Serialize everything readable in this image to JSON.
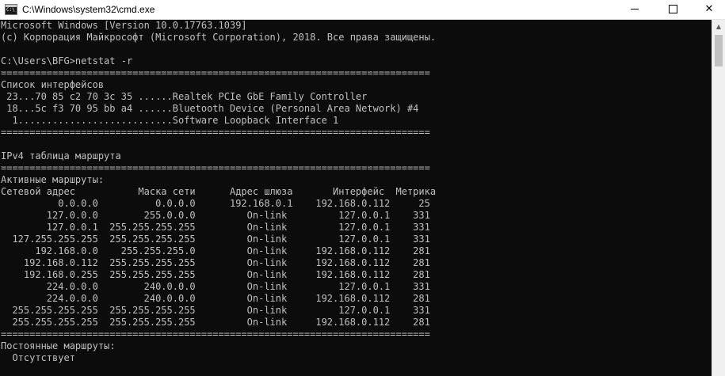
{
  "window": {
    "title": "C:\\Windows\\system32\\cmd.exe",
    "icon": "cmd-icon",
    "buttons": {
      "minimize_icon": "minimize-icon",
      "maximize_icon": "maximize-icon",
      "close_glyph": "✕"
    }
  },
  "scrollbar": {
    "up_glyph": "▲"
  },
  "colors": {
    "console_background": "#0c0c0c",
    "console_text": "#c0c0c0",
    "titlebar_background": "#ffffff"
  },
  "console": {
    "lines": [
      "Microsoft Windows [Version 10.0.17763.1039]",
      "(c) Корпорация Майкрософт (Microsoft Corporation), 2018. Все права защищены.",
      "",
      "C:\\Users\\BFG>netstat -r",
      "===========================================================================",
      "Список интерфейсов",
      " 23...70 85 c2 70 3c 35 ......Realtek PCIe GbE Family Controller",
      " 18...5c f3 70 95 bb a4 ......Bluetooth Device (Personal Area Network) #4",
      "  1...........................Software Loopback Interface 1",
      "===========================================================================",
      "",
      "IPv4 таблица маршрута",
      "===========================================================================",
      "Активные маршруты:",
      "Сетевой адрес           Маска сети      Адрес шлюза       Интерфейс  Метрика",
      "          0.0.0.0          0.0.0.0      192.168.0.1    192.168.0.112     25",
      "        127.0.0.0        255.0.0.0         On-link         127.0.0.1    331",
      "        127.0.0.1  255.255.255.255         On-link         127.0.0.1    331",
      "  127.255.255.255  255.255.255.255         On-link         127.0.0.1    331",
      "      192.168.0.0    255.255.255.0         On-link     192.168.0.112    281",
      "    192.168.0.112  255.255.255.255         On-link     192.168.0.112    281",
      "    192.168.0.255  255.255.255.255         On-link     192.168.0.112    281",
      "        224.0.0.0        240.0.0.0         On-link         127.0.0.1    331",
      "        224.0.0.0        240.0.0.0         On-link     192.168.0.112    281",
      "  255.255.255.255  255.255.255.255         On-link         127.0.0.1    331",
      "  255.255.255.255  255.255.255.255         On-link     192.168.0.112    281",
      "===========================================================================",
      "Постоянные маршруты:",
      "  Отсутствует"
    ]
  }
}
